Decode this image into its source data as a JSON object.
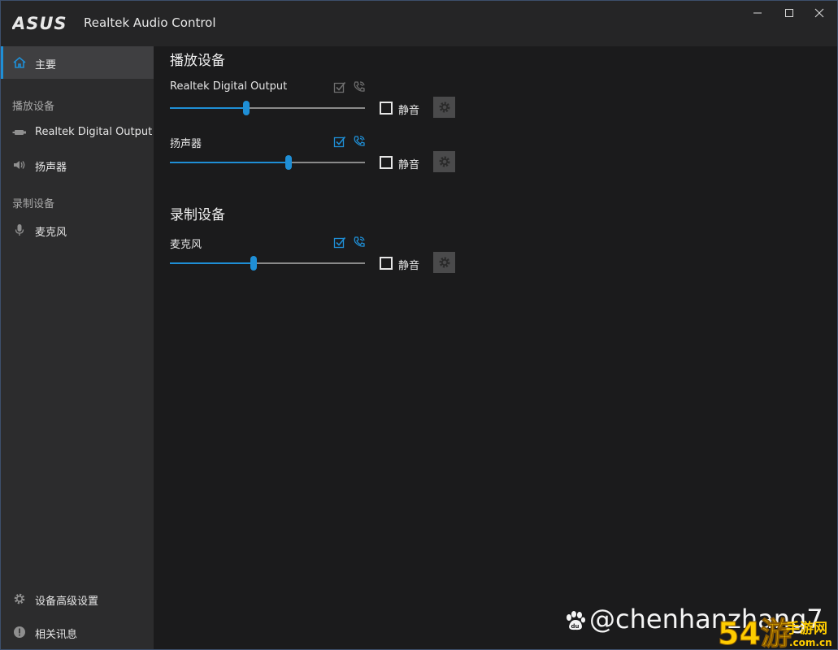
{
  "window": {
    "title": "Realtek Audio Control",
    "brand": "ASUS"
  },
  "sidebar": {
    "home_label": "主要",
    "playback_section": "播放设备",
    "recording_section": "录制设备",
    "playback_items": [
      {
        "label": "Realtek Digital Output",
        "icon": "digital-output-icon"
      },
      {
        "label": "扬声器",
        "icon": "speaker-icon"
      }
    ],
    "recording_items": [
      {
        "label": "麦克风",
        "icon": "microphone-icon"
      }
    ],
    "advanced_label": "设备高级设置",
    "info_label": "相关讯息"
  },
  "main": {
    "playback_title": "播放设备",
    "recording_title": "录制设备",
    "mute_label": "静音",
    "devices": [
      {
        "name": "Realtek Digital Output",
        "volume": 0.39,
        "muted": false,
        "default_active": false,
        "comm_active": false
      },
      {
        "name": "扬声器",
        "volume": 0.61,
        "muted": false,
        "default_active": true,
        "comm_active": true
      },
      {
        "name": "麦克风",
        "volume": 0.43,
        "muted": false,
        "default_active": true,
        "comm_active": true
      }
    ]
  },
  "watermark": {
    "text": "@chenhanzhang7",
    "logo_text": "54游",
    "logo_sub": "手游网",
    "logo_url": ".com.cn"
  },
  "colors": {
    "accent": "#1f8fd6",
    "sidebar_bg": "#2c2c2d",
    "main_bg": "#1b1b1c",
    "titlebar_bg": "#252526"
  }
}
